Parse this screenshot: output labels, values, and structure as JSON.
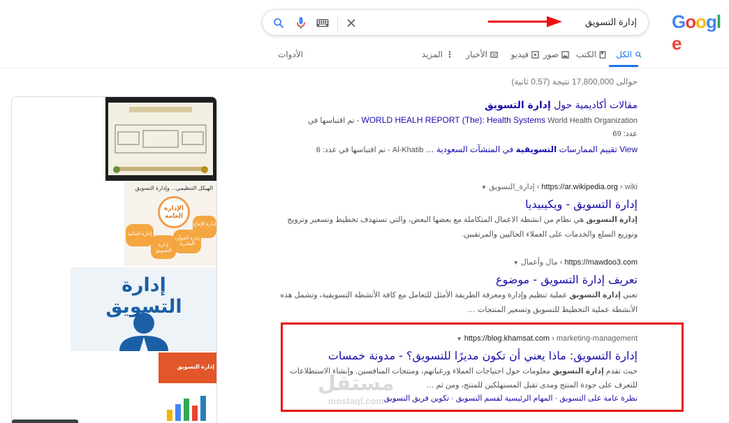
{
  "logo": {
    "letters": [
      "G",
      "o",
      "o",
      "g",
      "l",
      "e"
    ],
    "colors": [
      "#4285f4",
      "#ea4335",
      "#fbbc05",
      "#4285f4",
      "#34a853",
      "#ea4335"
    ]
  },
  "search": {
    "query": "إدارة التسويق",
    "icons": [
      "search-icon",
      "mic-icon",
      "keyboard-icon",
      "clear-icon"
    ]
  },
  "tabs": [
    {
      "label": "الكل",
      "icon": "search-icon",
      "active": true
    },
    {
      "label": "الكتب",
      "icon": "book-icon"
    },
    {
      "label": "صور",
      "icon": "image-icon"
    },
    {
      "label": "فيديو",
      "icon": "play-icon"
    },
    {
      "label": "الأخبار",
      "icon": "news-icon"
    },
    {
      "label": "المزيد",
      "icon": "more-vert-icon"
    },
    {
      "label": "الأدوات"
    }
  ],
  "stats": "حوالى 17,800,000 نتيجة (0.57 ثانية)",
  "scholar": {
    "title_pre": "مقالات أكاديمية حول ",
    "title_bold": "إدارة التسويق",
    "line1_link": "WORLD HEALH REPORT (The): Health Systems",
    "line1_meta": "World Health Organization - تم اقتباسها في",
    "line1_meta2": "عدد: 69",
    "line2_link_pre": "View تقييم الممارسات ",
    "line2_link_bold": "التسويقية",
    "line2_link_post": " في المنشآت السعودية …",
    "line2_meta": "Al-Khatib - تم اقتباسها في عدد: 6"
  },
  "results": [
    {
      "domain": "https://ar.wikipedia.org",
      "crumbs": "wiki › إدارة_التسويق",
      "title": "إدارة التسويق - ويكيبيديا",
      "snippet_bold": "إدارة التسويق",
      "snippet_rest": " هي نظام من انشطة الاعمال المتكاملة مع بعضها البعض، والتي تستهدف تخطيط وتسعير وترويج وتوزيع السلع والخدمات على العملاء الحاليين والمرتقبين."
    },
    {
      "domain": "https://mawdoo3.com",
      "crumbs": "مال وأعمال",
      "title": "تعريف إدارة التسويق - موضوع",
      "snippet_pre": "تعني ",
      "snippet_bold": "إدارة التسويق",
      "snippet_rest": " عملية تنظيم وإدارة ومعرفة الطريقة الأمثل للتعامل مع كافة الأنشطة التسويقية، وتشمل هذه الأنشطة عملية التخطيط للتسويق وتسعير المنتجات …"
    },
    {
      "domain": "https://blog.khamsat.com",
      "crumbs": "marketing-management",
      "title": "إدارة التسويق: ماذا يعني أن تكون مديرًا للتسويق؟ - مدونة خمسات",
      "snippet_pre": "حيث تقدم ",
      "snippet_bold": "إدارة التسويق",
      "snippet_rest": " معلومات حول احتياجات العملاء ورغباتهم، ومنتجات المنافسين. وإنشاء الاستطلاعات للتعرف على جودة المنتج ومدى تقبل المستهلكين للمنتج، ومن ثم …",
      "sitelinks": [
        "نظرة عامة على التسويق",
        "المهام الرئيسية لقسم التسويق",
        "تكوين فريق التسويق"
      ]
    }
  ],
  "images": {
    "img2_title": "الهيكل التنظيمي... وإدارة التسويق",
    "img2_center": "الإدارة العامة",
    "img2_petals": [
      "إدارة المالية",
      "إدارة التسويق",
      "إدارة الموارد البشرية",
      "إدارة الإنتاج"
    ],
    "img3_text": "إدارة التسويق",
    "img4_text": "إدارة التسويق"
  },
  "watermark": {
    "ar": "مستقل",
    "en": "mostaql.com"
  },
  "colors": {
    "link": "#1a0dab",
    "accent": "#1a73e8",
    "highlight": "#e81010",
    "arrow": "#ee1111"
  }
}
